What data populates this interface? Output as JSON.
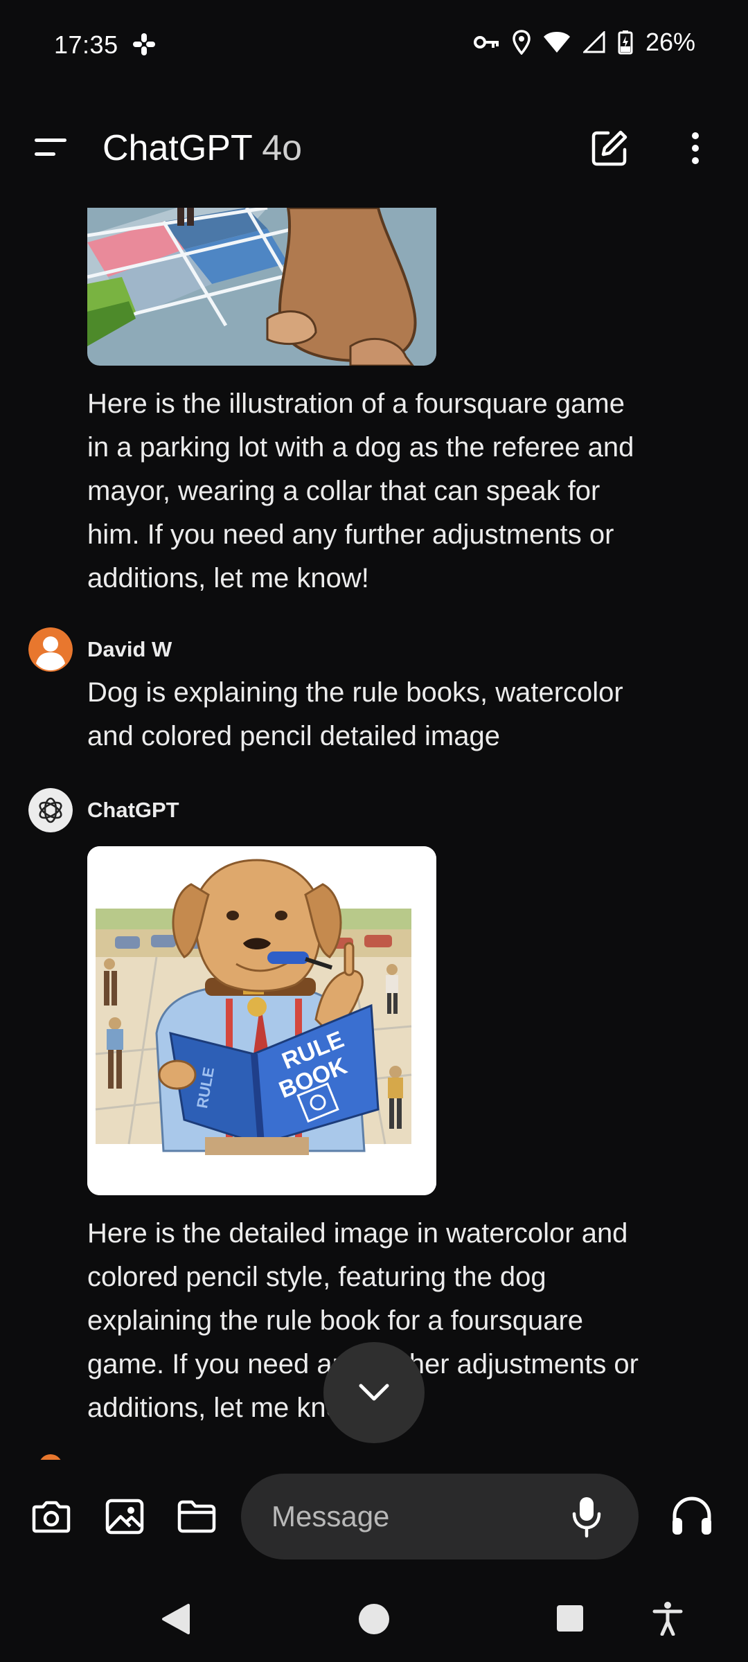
{
  "status_bar": {
    "time": "17:35",
    "battery_percent": "26%",
    "icons": [
      "slack-icon",
      "vpn-key-icon",
      "location-icon",
      "wifi-icon",
      "cell-signal-icon",
      "battery-charging-icon"
    ]
  },
  "app_bar": {
    "title": "ChatGPT",
    "model": "4o",
    "icons": [
      "menu-icon",
      "new-chat-icon",
      "more-vert-icon"
    ]
  },
  "messages": [
    {
      "role": "assistant",
      "image": "dog-referee-foursquare-illustration (partially scrolled)",
      "text": "Here is the illustration of a foursquare game in a parking lot with a dog as the referee and mayor, wearing a collar that can speak for him. If you need any further adjustments or additions, let me know!",
      "lines": [
        "Here is the illustration of a foursquare game",
        "in a parking lot with a dog as the referee and",
        "mayor, wearing a collar that can speak for",
        "him. If you need any further adjustments or",
        "additions, let me know!"
      ]
    },
    {
      "role": "user",
      "sender": "David W",
      "lines": [
        "Dog is explaining the rule books, watercolor",
        "and colored pencil detailed image"
      ]
    },
    {
      "role": "assistant",
      "sender": "ChatGPT",
      "image": "dog-explaining-rule-book-watercolor",
      "image_text": {
        "book_cover": "RULE BOOK",
        "book_spine": "RULE"
      },
      "lines": [
        "Here is the detailed image in watercolor and",
        "colored pencil style, featuring the dog",
        "explaining the rule book for a foursquare",
        "game. If you need any further adjustments or",
        "additions, let me know!"
      ]
    }
  ],
  "composer": {
    "placeholder": "Message",
    "icons": [
      "camera-icon",
      "image-icon",
      "folder-icon",
      "mic-icon",
      "headphones-icon"
    ]
  },
  "colors": {
    "background": "#0c0c0d",
    "pill": "#2a2a2b",
    "fab": "#2f2f2f",
    "user_avatar": "#e8772e",
    "text": "#ececec"
  }
}
